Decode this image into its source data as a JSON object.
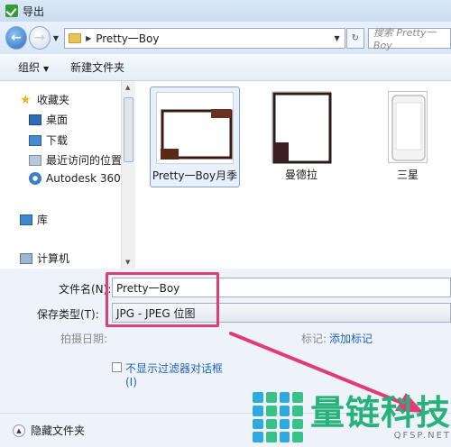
{
  "window": {
    "title": "导出"
  },
  "address": {
    "path": "Pretty一Boy",
    "search_placeholder": "搜索 Pretty一Boy"
  },
  "toolbar": {
    "organize": "组织",
    "new_folder": "新建文件夹"
  },
  "nav": {
    "favorites": "收藏夹",
    "items": [
      "桌面",
      "下载",
      "最近访问的位置",
      "Autodesk 360"
    ],
    "library": "库",
    "computer": "计算机"
  },
  "files": [
    {
      "name": "Pretty一Boy月季"
    },
    {
      "name": "曼德拉"
    },
    {
      "name": "三星"
    }
  ],
  "form": {
    "filename_label": "文件名(N):",
    "filename_value": "Pretty一Boy",
    "filetype_label": "保存类型(T):",
    "filetype_value": "JPG - JPEG 位图",
    "date_label": "拍摄日期:",
    "tags_label": "标记:",
    "tags_link": "添加标记",
    "checkbox_label": "不显示过滤器对话框",
    "checkbox_label2": "(I)"
  },
  "bottom": {
    "hide_folders": "隐藏文件夹"
  },
  "watermark": {
    "brand": "量链科技",
    "url": "QFSP.NET"
  },
  "colors": {
    "highlight": "#e03c78",
    "link": "#1f62b8"
  }
}
